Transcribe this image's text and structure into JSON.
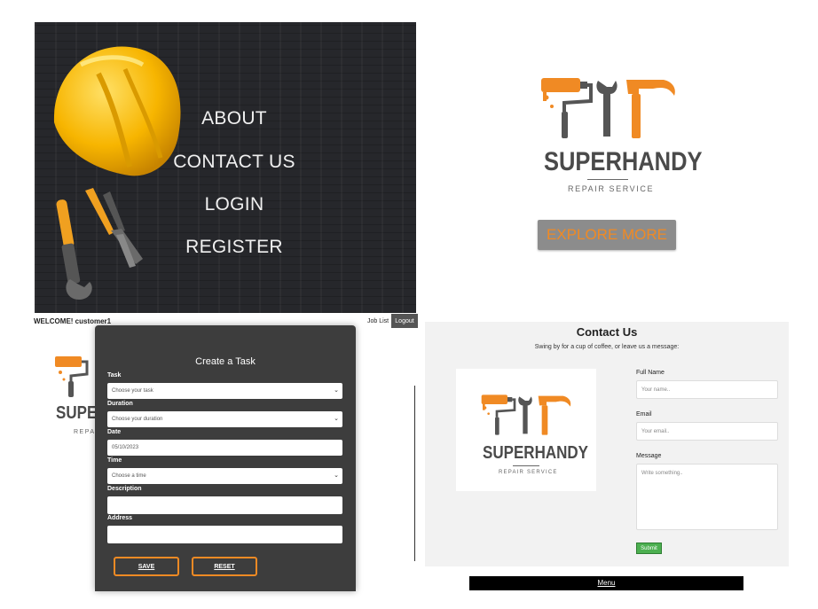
{
  "hero": {
    "menu": [
      "ABOUT",
      "CONTACT US",
      "LOGIN",
      "REGISTER"
    ]
  },
  "status_bar": {
    "welcome": "WELCOME! customer1",
    "job_list": "Job List",
    "logout": "Logout"
  },
  "brand": {
    "name": "SUPERHANDY",
    "tagline": "REPAIR SERVICE",
    "partial_name": "SUPEI",
    "partial_tagline": "REPAI"
  },
  "explore": {
    "label": "EXPLORE MORE"
  },
  "task_form": {
    "title": "Create a Task",
    "fields": [
      {
        "label": "Task",
        "value": "Choose your task",
        "type": "select"
      },
      {
        "label": "Duration",
        "value": "Choose your duration",
        "type": "select"
      },
      {
        "label": "Date",
        "value": "05/10/2023",
        "type": "date"
      },
      {
        "label": "Time",
        "value": "Choose a time",
        "type": "select"
      },
      {
        "label": "Description",
        "value": "",
        "type": "text"
      },
      {
        "label": "Address",
        "value": "",
        "type": "text"
      }
    ],
    "save_label": "SAVE",
    "reset_label": "RESET"
  },
  "contact": {
    "title": "Contact Us",
    "subtitle": "Swing by for a cup of coffee, or leave us a message:",
    "name_label": "Full Name",
    "name_placeholder": "Your name..",
    "email_label": "Email",
    "email_placeholder": "Your email..",
    "message_label": "Message",
    "message_placeholder": "Write something..",
    "submit_label": "Submit"
  },
  "footer": {
    "menu_label": "Menu"
  },
  "colors": {
    "accent": "#f08a24",
    "dark": "#3d3d3d",
    "submit": "#4caf50"
  }
}
